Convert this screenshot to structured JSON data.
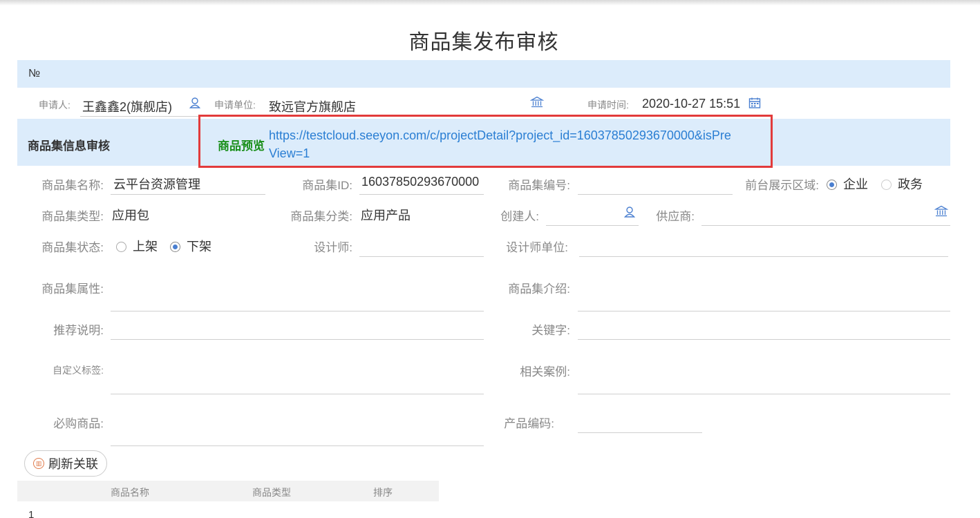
{
  "page": {
    "title": "商品集发布审核"
  },
  "number_bar": {
    "label": "№"
  },
  "applicant": {
    "applicant_label": "申请人:",
    "applicant_value": "王鑫鑫2(旗舰店)",
    "unit_label": "申请单位:",
    "unit_value": "致远官方旗舰店",
    "time_label": "申请时间:",
    "time_value": "2020-10-27 15:51"
  },
  "section": {
    "title": "商品集信息审核",
    "preview_label": "商品预览",
    "preview_link_line1": "https://testcloud.seeyon.com/c/projectDetail?project_id=16037850293670000&isPre",
    "preview_link_line2": "View=1"
  },
  "form": {
    "name_label": "商品集名称:",
    "name_value": "云平台资源管理",
    "id_label": "商品集ID:",
    "id_value": "16037850293670000",
    "code_label": "商品集编号:",
    "code_value": "",
    "region_label": "前台展示区域:",
    "region_options": [
      "企业",
      "政务"
    ],
    "region_selected": "企业",
    "type_label": "商品集类型:",
    "type_value": "应用包",
    "category_label": "商品集分类:",
    "category_value": "应用产品",
    "creator_label": "创建人:",
    "creator_value": "",
    "supplier_label": "供应商:",
    "supplier_value": "",
    "status_label": "商品集状态:",
    "status_options": [
      "上架",
      "下架"
    ],
    "status_selected": "下架",
    "designer_label": "设计师:",
    "designer_value": "",
    "designer_unit_label": "设计师单位:",
    "designer_unit_value": "",
    "attr_label": "商品集属性:",
    "intro_label": "商品集介绍:",
    "recommend_label": "推荐说明:",
    "keyword_label": "关键字:",
    "custom_tag_label": "自定义标签:",
    "case_label": "相关案例:",
    "required_label": "必购商品:",
    "product_code_label": "产品编码:"
  },
  "actions": {
    "refresh_label": "刷新关联"
  },
  "table": {
    "columns": [
      "商品名称",
      "商品类型",
      "排序"
    ],
    "rows": [
      {
        "index": "1"
      }
    ]
  },
  "colors": {
    "band": "#dcecfb",
    "accent": "#4a7fd0",
    "highlight_border": "#e23b3b",
    "preview_label": "#1a8f1a",
    "link": "#2a7ed3"
  }
}
